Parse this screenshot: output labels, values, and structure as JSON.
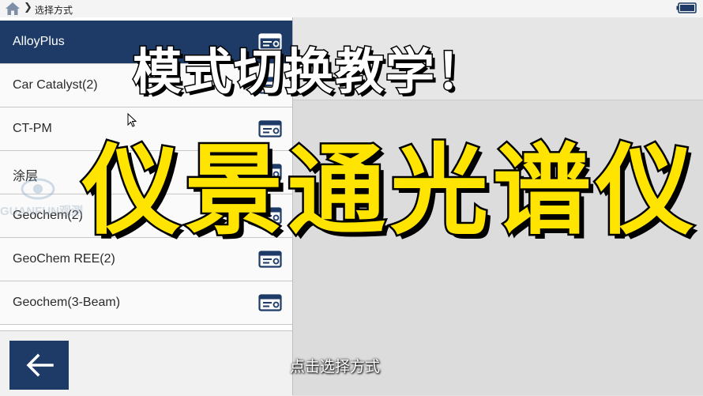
{
  "header": {
    "breadcrumb": "选择方式",
    "home_icon": "home-icon",
    "battery_icon": "battery-icon"
  },
  "modes": [
    {
      "label": "AlloyPlus",
      "selected": true
    },
    {
      "label": "Car Catalyst(2)"
    },
    {
      "label": "CT-PM"
    },
    {
      "label": "涂层"
    },
    {
      "label": "Geochem(2)"
    },
    {
      "label": "GeoChem REE(2)"
    },
    {
      "label": "Geochem(3-Beam)"
    }
  ],
  "footer": {
    "back_icon": "arrow-left-icon"
  },
  "overlay": {
    "title": "模式切换教学！",
    "product": "仪景通光谱仪",
    "subtitle": "点击选择方式",
    "watermark": "GUANFUN观测"
  },
  "colors": {
    "accent": "#1d3b66",
    "highlight_text": "#ffe400",
    "panel_bg": "#dcdcdc"
  }
}
